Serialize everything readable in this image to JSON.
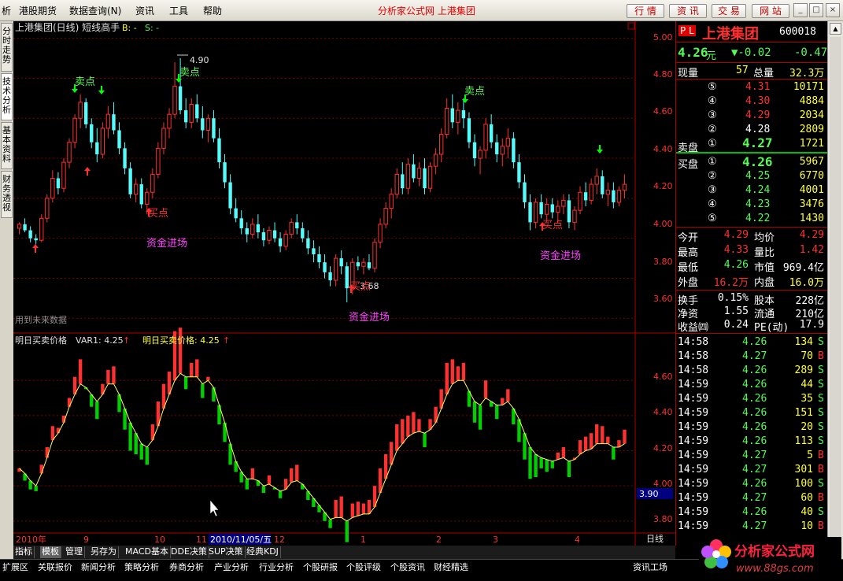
{
  "menubar": {
    "items": [
      "析",
      "港股期货",
      "数据查询(N)",
      "资讯",
      "工具",
      "帮助"
    ],
    "app_title": "分析家公式网  上港集团",
    "buttons": [
      "行 情",
      "资 讯",
      "交 易",
      "网 站"
    ],
    "win_buttons": [
      "_",
      "□",
      "×"
    ]
  },
  "side_tabs": [
    "分时走势",
    "技术分析",
    "基本资料",
    "财务透视"
  ],
  "main_chart": {
    "header": "上港集团(日线) 短线高手",
    "b_label": "B: -",
    "s_label": "S: -",
    "y_ticks": [
      "5.00",
      "4.80",
      "4.60",
      "4.40",
      "4.20",
      "4.00",
      "3.80",
      "3.60"
    ],
    "annotations": {
      "max_price": "4.90",
      "min_price": "3.68",
      "sell": "卖点",
      "buy": "买点",
      "fund_in": "资金进场",
      "future_data": "用到未来数据"
    },
    "fund_in_labels": [
      "资金进场",
      "资金进场",
      "资金进场"
    ]
  },
  "sub_chart": {
    "title": "明日买卖价格",
    "var1_label": "VAR1: 4.25",
    "title2": "明日买卖价格: 4.25",
    "y_ticks": [
      "4.60",
      "4.40",
      "4.20",
      "4.00",
      "3.80"
    ],
    "current_value": "3.90",
    "period_label": "日线",
    "zoom_plus": "+",
    "zoom_minus": "-"
  },
  "x_axis": {
    "labels": [
      "2010年",
      "9",
      "10",
      "11",
      "2010/11/05/五",
      "12",
      "1",
      "2",
      "3",
      "4"
    ]
  },
  "chart_data": {
    "type": "candlestick",
    "title": "上港集团(日线) 短线高手",
    "y_range": [
      3.55,
      5.03
    ],
    "candles": [
      [
        4.05,
        4.08,
        4.02,
        4.07
      ],
      [
        4.07,
        4.1,
        4.03,
        4.04
      ],
      [
        4.04,
        4.06,
        3.98,
        4.0
      ],
      [
        4.0,
        4.02,
        3.97,
        3.99
      ],
      [
        3.99,
        4.12,
        3.98,
        4.1
      ],
      [
        4.1,
        4.22,
        4.08,
        4.2
      ],
      [
        4.2,
        4.34,
        4.18,
        4.3
      ],
      [
        4.3,
        4.33,
        4.22,
        4.25
      ],
      [
        4.25,
        4.4,
        4.23,
        4.38
      ],
      [
        4.38,
        4.5,
        4.35,
        4.48
      ],
      [
        4.48,
        4.62,
        4.45,
        4.6
      ],
      [
        4.6,
        4.72,
        4.55,
        4.68
      ],
      [
        4.68,
        4.7,
        4.55,
        4.57
      ],
      [
        4.57,
        4.6,
        4.45,
        4.48
      ],
      [
        4.48,
        4.55,
        4.38,
        4.42
      ],
      [
        4.42,
        4.58,
        4.4,
        4.55
      ],
      [
        4.55,
        4.66,
        4.5,
        4.62
      ],
      [
        4.62,
        4.68,
        4.52,
        4.54
      ],
      [
        4.54,
        4.58,
        4.42,
        4.45
      ],
      [
        4.45,
        4.48,
        4.32,
        4.35
      ],
      [
        4.35,
        4.38,
        4.2,
        4.22
      ],
      [
        4.22,
        4.3,
        4.18,
        4.27
      ],
      [
        4.27,
        4.3,
        4.15,
        4.17
      ],
      [
        4.17,
        4.25,
        4.12,
        4.23
      ],
      [
        4.23,
        4.35,
        4.2,
        4.32
      ],
      [
        4.32,
        4.48,
        4.3,
        4.45
      ],
      [
        4.45,
        4.58,
        4.42,
        4.55
      ],
      [
        4.55,
        4.65,
        4.5,
        4.62
      ],
      [
        4.62,
        4.88,
        4.6,
        4.76
      ],
      [
        4.76,
        4.9,
        4.62,
        4.64
      ],
      [
        4.64,
        4.7,
        4.55,
        4.58
      ],
      [
        4.58,
        4.7,
        4.55,
        4.67
      ],
      [
        4.67,
        4.72,
        4.58,
        4.6
      ],
      [
        4.6,
        4.66,
        4.5,
        4.54
      ],
      [
        4.54,
        4.62,
        4.48,
        4.6
      ],
      [
        4.6,
        4.64,
        4.48,
        4.5
      ],
      [
        4.5,
        4.55,
        4.35,
        4.38
      ],
      [
        4.38,
        4.42,
        4.25,
        4.28
      ],
      [
        4.28,
        4.32,
        4.12,
        4.15
      ],
      [
        4.15,
        4.2,
        4.08,
        4.1
      ],
      [
        4.1,
        4.14,
        4.02,
        4.05
      ],
      [
        4.05,
        4.08,
        3.98,
        4.02
      ],
      [
        4.02,
        4.1,
        4.0,
        4.07
      ],
      [
        4.07,
        4.12,
        4.0,
        4.03
      ],
      [
        4.03,
        4.05,
        3.96,
        3.99
      ],
      [
        3.99,
        4.06,
        3.97,
        4.04
      ],
      [
        4.04,
        4.08,
        3.98,
        4.0
      ],
      [
        4.0,
        4.03,
        3.93,
        3.96
      ],
      [
        3.96,
        4.04,
        3.94,
        4.02
      ],
      [
        4.02,
        4.1,
        4.0,
        4.08
      ],
      [
        4.08,
        4.12,
        4.02,
        4.05
      ],
      [
        4.05,
        4.08,
        3.98,
        4.0
      ],
      [
        4.0,
        4.04,
        3.92,
        3.95
      ],
      [
        3.95,
        3.99,
        3.88,
        3.92
      ],
      [
        3.92,
        3.96,
        3.85,
        3.88
      ],
      [
        3.88,
        3.92,
        3.8,
        3.83
      ],
      [
        3.83,
        3.86,
        3.76,
        3.79
      ],
      [
        3.79,
        3.92,
        3.76,
        3.9
      ],
      [
        3.9,
        3.94,
        3.82,
        3.86
      ],
      [
        3.86,
        3.88,
        3.68,
        3.75
      ],
      [
        3.75,
        3.9,
        3.72,
        3.88
      ],
      [
        3.88,
        3.91,
        3.84,
        3.86
      ],
      [
        3.86,
        3.9,
        3.82,
        3.88
      ],
      [
        3.88,
        3.92,
        3.84,
        3.85
      ],
      [
        3.85,
        4.0,
        3.83,
        3.98
      ],
      [
        3.98,
        4.1,
        3.95,
        4.07
      ],
      [
        4.07,
        4.18,
        4.05,
        4.15
      ],
      [
        4.15,
        4.25,
        4.1,
        4.22
      ],
      [
        4.22,
        4.35,
        4.2,
        4.32
      ],
      [
        4.32,
        4.38,
        4.22,
        4.25
      ],
      [
        4.25,
        4.4,
        4.22,
        4.37
      ],
      [
        4.37,
        4.42,
        4.28,
        4.3
      ],
      [
        4.3,
        4.38,
        4.26,
        4.35
      ],
      [
        4.35,
        4.4,
        4.22,
        4.25
      ],
      [
        4.25,
        4.38,
        4.23,
        4.36
      ],
      [
        4.36,
        4.45,
        4.32,
        4.42
      ],
      [
        4.42,
        4.55,
        4.38,
        4.52
      ],
      [
        4.52,
        4.7,
        4.5,
        4.65
      ],
      [
        4.65,
        4.72,
        4.55,
        4.58
      ],
      [
        4.58,
        4.68,
        4.52,
        4.64
      ],
      [
        4.64,
        4.7,
        4.55,
        4.6
      ],
      [
        4.6,
        4.63,
        4.45,
        4.48
      ],
      [
        4.48,
        4.52,
        4.36,
        4.4
      ],
      [
        4.4,
        4.46,
        4.32,
        4.44
      ],
      [
        4.44,
        4.6,
        4.4,
        4.57
      ],
      [
        4.57,
        4.62,
        4.45,
        4.48
      ],
      [
        4.48,
        4.52,
        4.38,
        4.42
      ],
      [
        4.42,
        4.5,
        4.36,
        4.46
      ],
      [
        4.46,
        4.55,
        4.4,
        4.5
      ],
      [
        4.5,
        4.53,
        4.35,
        4.38
      ],
      [
        4.38,
        4.42,
        4.25,
        4.28
      ],
      [
        4.28,
        4.32,
        4.15,
        4.18
      ],
      [
        4.18,
        4.22,
        4.04,
        4.08
      ],
      [
        4.08,
        4.2,
        4.05,
        4.18
      ],
      [
        4.18,
        4.22,
        4.1,
        4.12
      ],
      [
        4.12,
        4.2,
        4.08,
        4.17
      ],
      [
        4.17,
        4.2,
        4.1,
        4.13
      ],
      [
        4.13,
        4.19,
        4.08,
        4.16
      ],
      [
        4.16,
        4.22,
        4.12,
        4.19
      ],
      [
        4.19,
        4.22,
        4.05,
        4.08
      ],
      [
        4.08,
        4.16,
        4.04,
        4.14
      ],
      [
        4.14,
        4.26,
        4.12,
        4.23
      ],
      [
        4.23,
        4.28,
        4.16,
        4.19
      ],
      [
        4.19,
        4.3,
        4.17,
        4.27
      ],
      [
        4.27,
        4.35,
        4.22,
        4.31
      ],
      [
        4.31,
        4.34,
        4.2,
        4.22
      ],
      [
        4.22,
        4.28,
        4.16,
        4.24
      ],
      [
        4.24,
        4.28,
        4.15,
        4.18
      ],
      [
        4.18,
        4.26,
        4.16,
        4.24
      ],
      [
        4.24,
        4.32,
        4.2,
        4.27
      ]
    ],
    "sub_range": [
      3.75,
      4.78
    ],
    "sub_line": [
      4.1,
      4.07,
      4.03,
      4.0,
      4.07,
      4.16,
      4.26,
      4.3,
      4.36,
      4.45,
      4.52,
      4.58,
      4.56,
      4.52,
      4.48,
      4.52,
      4.58,
      4.58,
      4.52,
      4.44,
      4.36,
      4.3,
      4.24,
      4.22,
      4.26,
      4.34,
      4.44,
      4.52,
      4.6,
      4.64,
      4.62,
      4.62,
      4.62,
      4.58,
      4.6,
      4.56,
      4.46,
      4.36,
      4.24,
      4.14,
      4.08,
      4.04,
      4.04,
      4.03,
      4.0,
      4.01,
      3.99,
      3.97,
      3.98,
      4.02,
      4.03,
      4.01,
      3.97,
      3.93,
      3.89,
      3.85,
      3.81,
      3.82,
      3.82,
      3.8,
      3.82,
      3.83,
      3.84,
      3.84,
      3.88,
      3.96,
      4.04,
      4.12,
      4.2,
      4.24,
      4.28,
      4.3,
      4.31,
      4.3,
      4.32,
      4.36,
      4.44,
      4.52,
      4.58,
      4.6,
      4.6,
      4.54,
      4.48,
      4.46,
      4.5,
      4.48,
      4.46,
      4.46,
      4.48,
      4.44,
      4.38,
      4.3,
      4.22,
      4.18,
      4.16,
      4.15,
      4.14,
      4.15,
      4.16,
      4.14,
      4.15,
      4.18,
      4.2,
      4.21,
      4.24,
      4.24,
      4.24,
      4.22,
      4.22,
      4.24
    ]
  },
  "quote": {
    "pl_label": "P L",
    "name": "上港集团",
    "code": "600018",
    "price": "4.26",
    "price_unit": "元",
    "change": "▼-0.02",
    "change_pct": "-0.47",
    "volume_label": "现量",
    "volume": "57",
    "total_label": "总量",
    "total": "32.3万",
    "sell_label": "卖盘",
    "buy_label": "买盘",
    "asks": [
      {
        "lvl": "⑤",
        "price": "4.31",
        "vol": "10171"
      },
      {
        "lvl": "④",
        "price": "4.30",
        "vol": "4884"
      },
      {
        "lvl": "③",
        "price": "4.29",
        "vol": "2034"
      },
      {
        "lvl": "②",
        "price": "4.28",
        "vol": "2809"
      },
      {
        "lvl": "①",
        "price": "4.27",
        "vol": "1721"
      }
    ],
    "bids": [
      {
        "lvl": "①",
        "price": "4.26",
        "vol": "5967"
      },
      {
        "lvl": "②",
        "price": "4.25",
        "vol": "6770"
      },
      {
        "lvl": "③",
        "price": "4.24",
        "vol": "4001"
      },
      {
        "lvl": "④",
        "price": "4.23",
        "vol": "3476"
      },
      {
        "lvl": "⑤",
        "price": "4.22",
        "vol": "1430"
      }
    ],
    "stats": [
      {
        "l1": "今开",
        "v1": "4.29",
        "l2": "均价",
        "v2": "4.29"
      },
      {
        "l1": "最高",
        "v1": "4.33",
        "l2": "量比",
        "v2": "1.42"
      },
      {
        "l1": "最低",
        "v1": "4.26",
        "l2": "市值",
        "v2": "969.4亿"
      },
      {
        "l1": "外盘",
        "v1": "16.2万",
        "l2": "内盘",
        "v2": "16.0万"
      }
    ],
    "fin": [
      {
        "l1": "换手",
        "v1": "0.15%",
        "l2": "股本",
        "v2": "228亿"
      },
      {
        "l1": "净资",
        "v1": "1.55",
        "l2": "流通",
        "v2": "210亿"
      },
      {
        "l1": "收益㈣",
        "v1": "0.24",
        "l2": "PE(动)",
        "v2": "17.9"
      }
    ],
    "ticks": [
      {
        "t": "14:58",
        "p": "4.26",
        "v": "134",
        "s": "S"
      },
      {
        "t": "14:58",
        "p": "4.27",
        "v": "70",
        "s": "B"
      },
      {
        "t": "14:58",
        "p": "4.26",
        "v": "289",
        "s": "S"
      },
      {
        "t": "14:59",
        "p": "4.26",
        "v": "44",
        "s": "S"
      },
      {
        "t": "14:59",
        "p": "4.26",
        "v": "35",
        "s": "S"
      },
      {
        "t": "14:59",
        "p": "4.26",
        "v": "151",
        "s": "S"
      },
      {
        "t": "14:59",
        "p": "4.26",
        "v": "20",
        "s": "S"
      },
      {
        "t": "14:59",
        "p": "4.26",
        "v": "113",
        "s": "S"
      },
      {
        "t": "14:59",
        "p": "4.27",
        "v": "5",
        "s": "B"
      },
      {
        "t": "14:59",
        "p": "4.27",
        "v": "301",
        "s": "B"
      },
      {
        "t": "14:59",
        "p": "4.26",
        "v": "100",
        "s": "S"
      },
      {
        "t": "14:59",
        "p": "4.27",
        "v": "60",
        "s": "B"
      },
      {
        "t": "14:59",
        "p": "4.26",
        "v": "40",
        "s": "S"
      },
      {
        "t": "14:59",
        "p": "4.27",
        "v": "10",
        "s": "B"
      }
    ]
  },
  "bottom_tabs": [
    "指标",
    "模板",
    "管理",
    "另存为",
    "MACD基本",
    "DDE决策",
    "SUP决策",
    "经典KDJ"
  ],
  "status_bar": [
    "扩展区",
    "关联报价",
    "新闻分析",
    "策略分析",
    "券商分析",
    "产业分析",
    "行业分析",
    "个股研报",
    "个股评级",
    "个股资讯",
    "财经精选",
    "资讯工场"
  ],
  "logo": {
    "name": "分析家公式网",
    "url": "www.88gs.com"
  },
  "colors": {
    "up": "#ff3030",
    "down": "#54fcfc",
    "sub_down": "#00d000",
    "grid": "#8b0000",
    "axis_text": "#ff3030",
    "pink": "#ff40ff",
    "yellow": "#ffff00"
  }
}
